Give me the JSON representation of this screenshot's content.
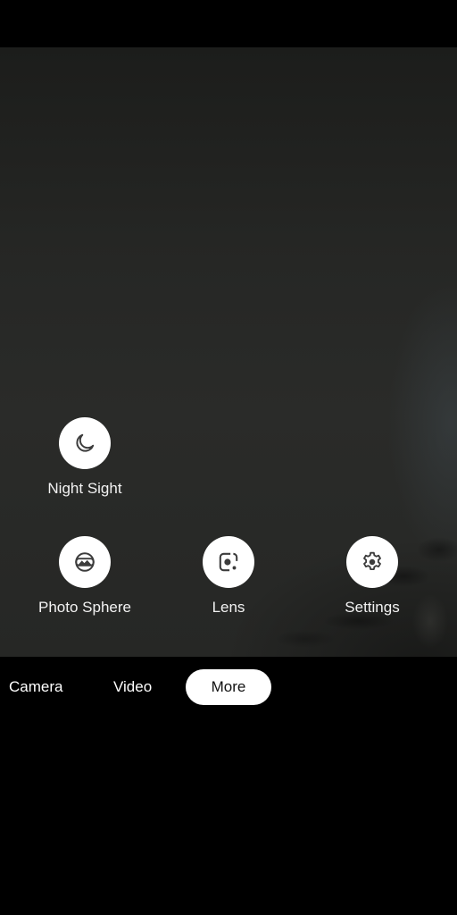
{
  "viewfinder": {
    "description": "camera preview"
  },
  "modes_panel": {
    "items": [
      {
        "id": "night-sight",
        "label": "Night Sight",
        "icon": "moon-icon"
      },
      {
        "id": "photo-sphere",
        "label": "Photo Sphere",
        "icon": "photo-sphere-icon"
      },
      {
        "id": "lens",
        "label": "Lens",
        "icon": "lens-icon"
      },
      {
        "id": "settings",
        "label": "Settings",
        "icon": "gear-icon"
      }
    ]
  },
  "mode_tabs": {
    "items": [
      {
        "label": "Camera",
        "selected": false
      },
      {
        "label": "Video",
        "selected": false
      },
      {
        "label": "More",
        "selected": true
      }
    ]
  },
  "colors": {
    "chip_bg": "#ffffff",
    "icon": "#3c3c3c",
    "background": "#000000"
  }
}
